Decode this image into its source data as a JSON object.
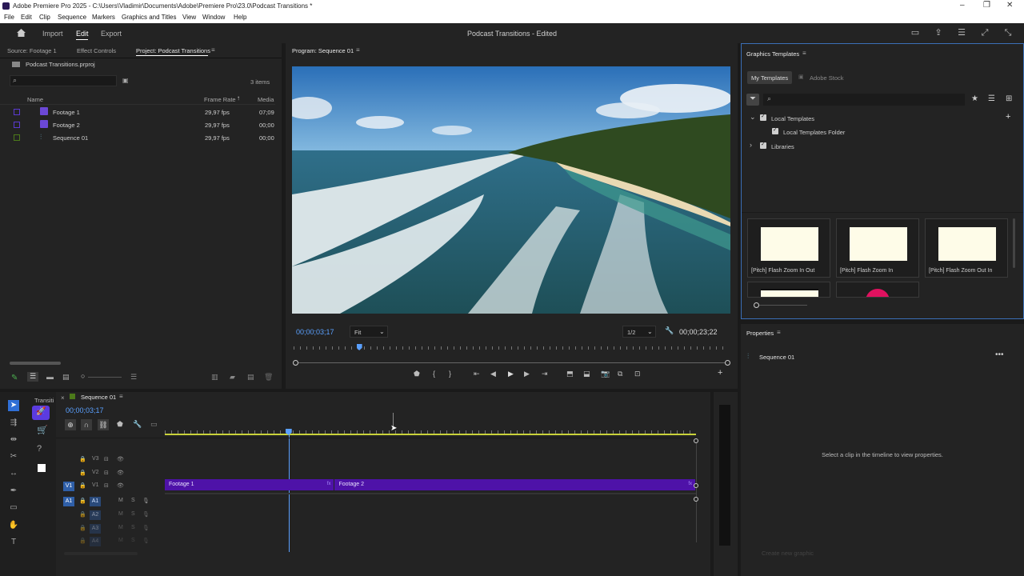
{
  "window": {
    "title": "Adobe Premiere Pro 2025 - C:\\Users\\Vladimir\\Documents\\Adobe\\Premiere Pro\\23.0\\Podcast Transitions *"
  },
  "menu": [
    "File",
    "Edit",
    "Clip",
    "Sequence",
    "Markers",
    "Graphics and Titles",
    "View",
    "Window",
    "Help"
  ],
  "header": {
    "import": "Import",
    "edit": "Edit",
    "export": "Export",
    "project_title": "Podcast Transitions - Edited"
  },
  "project_panel": {
    "tabs": [
      "Source: Footage 1",
      "Effect Controls",
      "Project: Podcast Transitions"
    ],
    "file": "Podcast Transitions.prproj",
    "items_count": "3 items",
    "columns": {
      "name": "Name",
      "frame_rate": "Frame Rate",
      "media": "Media"
    },
    "rows": [
      {
        "name": "Footage 1",
        "fps": "29,97 fps",
        "media": "07;09",
        "color": "#5a3ad0"
      },
      {
        "name": "Footage 2",
        "fps": "29,97 fps",
        "media": "00;00",
        "color": "#5a3ad0"
      },
      {
        "name": "Sequence 01",
        "fps": "29,97 fps",
        "media": "00;00",
        "color": "#4c7a1a"
      }
    ]
  },
  "program": {
    "tab": "Program: Sequence 01",
    "timecode": "00;00;03;17",
    "fit": "Fit",
    "resolution": "1/2",
    "duration": "00;00;23;22",
    "playhead_fraction": 0.15
  },
  "graphics": {
    "title": "Graphics Templates",
    "tabs": [
      "My Templates",
      "Adobe Stock"
    ],
    "tree": [
      {
        "label": "Local Templates",
        "level": 0,
        "expanded": true
      },
      {
        "label": "Local Templates Folder",
        "level": 1
      },
      {
        "label": "Libraries",
        "level": 0,
        "expanded": false
      }
    ],
    "cards": [
      "[Pitch] Flash Zoom In Out",
      "[Pitch] Flash Zoom In",
      "[Pitch] Flash Zoom Out In"
    ]
  },
  "properties": {
    "title": "Properties",
    "sequence": "Sequence 01",
    "empty_msg": "Select a clip in the timeline to view properties.",
    "create_graphic": "Create new graphic"
  },
  "timeline": {
    "tabs": [
      "Transiti",
      "Sequence 01"
    ],
    "timecode": "00;00;03;17",
    "video_tracks": [
      "V3",
      "V2",
      "V1"
    ],
    "audio_tracks": [
      "A1",
      "A2",
      "A3",
      "A4"
    ],
    "source_v": "V1",
    "source_a": "A1",
    "clips": [
      {
        "name": "Footage 1",
        "start": 0.0,
        "end": 0.32
      },
      {
        "name": "Footage 2",
        "start": 0.32,
        "end": 1.0
      }
    ],
    "playhead_fraction": 0.233
  },
  "colors": {
    "accent": "#5aa0ff",
    "clip": "#4e12a8",
    "timeline_bar": "#c9d23a"
  }
}
